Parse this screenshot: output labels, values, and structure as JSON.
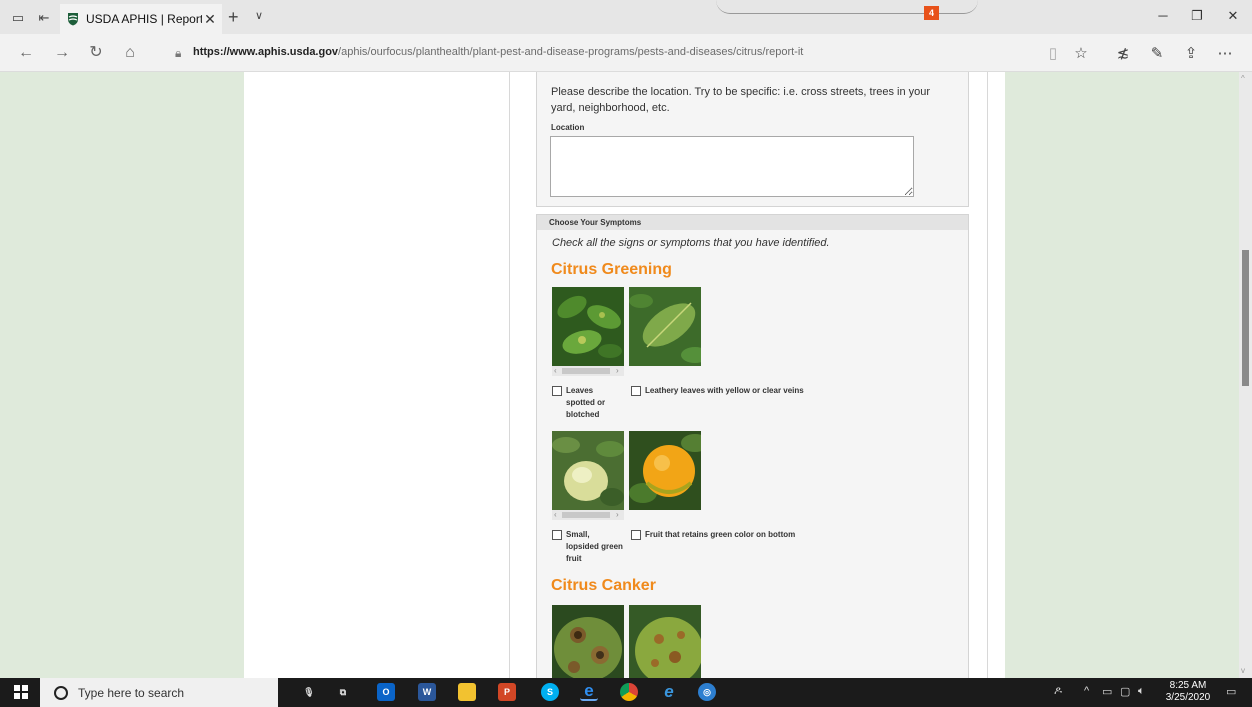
{
  "browser": {
    "tab_title": "USDA APHIS | Report Si",
    "tab_close": "✕",
    "new_tab": "+",
    "tab_menu": "∨",
    "notification_count": "4",
    "url_domain": "https://www.aphis.usda.gov",
    "url_path": "/aphis/ourfocus/planthealth/plant-pest-and-disease-programs/pests-and-diseases/citrus/report-it",
    "accent": "#e8521a"
  },
  "location_panel": {
    "description": "Please describe the location. Try to be specific: i.e. cross streets, trees in your yard, neighborhood, etc.",
    "label": "Location",
    "value": ""
  },
  "symptoms_panel": {
    "header": "Choose Your Symptoms",
    "intro": "Check all the signs or symptoms that you have identified.",
    "sections": [
      {
        "title": "Citrus Greening",
        "options": [
          {
            "label": "Leaves spotted or blotched",
            "checked": false
          },
          {
            "label": "Leathery leaves with yellow or clear veins",
            "checked": false
          },
          {
            "label": "Small, lopsided green fruit",
            "checked": false
          },
          {
            "label": "Fruit that retains green color on bottom",
            "checked": false
          }
        ]
      },
      {
        "title": "Citrus Canker",
        "options": []
      }
    ],
    "title_color": "#f08a1c"
  },
  "taskbar": {
    "search_placeholder": "Type here to search",
    "time": "8:25 AM",
    "date": "3/25/2020"
  }
}
